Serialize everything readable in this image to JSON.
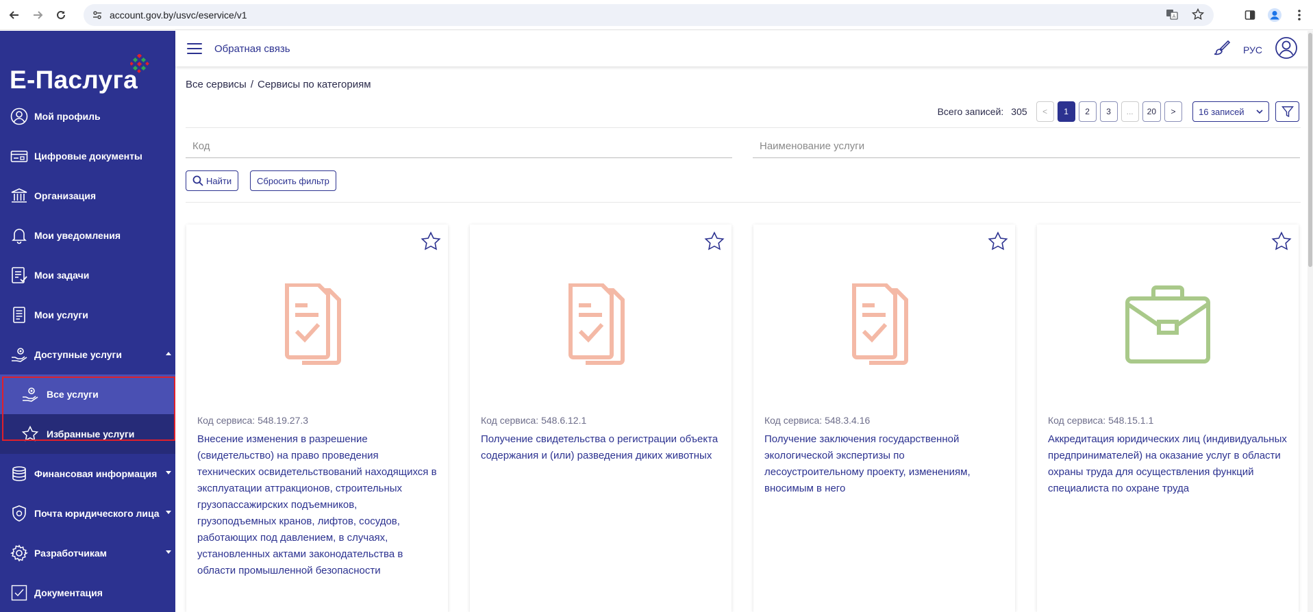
{
  "browser": {
    "url": "account.gov.by/usvc/eservice/v1"
  },
  "sidebar": {
    "logo_text": "Е-Паслуга",
    "items": [
      {
        "label": "Мой профиль",
        "icon": "user-circle-icon"
      },
      {
        "label": "Цифровые документы",
        "icon": "card-icon"
      },
      {
        "label": "Организация",
        "icon": "building-icon"
      },
      {
        "label": "Мои уведомления",
        "icon": "bell-icon"
      },
      {
        "label": "Мои задачи",
        "icon": "task-list-icon"
      },
      {
        "label": "Мои услуги",
        "icon": "document-icon"
      },
      {
        "label": "Доступные услуги",
        "icon": "hand-gear-icon",
        "expanded": true
      },
      {
        "label": "Все услуги",
        "icon": "hand-gear-icon",
        "sub": true,
        "active": true
      },
      {
        "label": "Избранные услуги",
        "icon": "star-icon",
        "sub": true
      },
      {
        "label": "Финансовая информация",
        "icon": "coins-icon"
      },
      {
        "label": "Почта юридического лица",
        "icon": "shield-mail-icon"
      },
      {
        "label": "Разработчикам",
        "icon": "gear-icon"
      },
      {
        "label": "Документация",
        "icon": "checkbox-icon"
      }
    ]
  },
  "topbar": {
    "feedback": "Обратная связь",
    "lang": "РУС"
  },
  "breadcrumb": {
    "root": "Все сервисы",
    "sep": "/",
    "current": "Сервисы по категориям"
  },
  "pager": {
    "label": "Всего записей:",
    "total": "305",
    "prev": "<",
    "pages": [
      "1",
      "2",
      "3",
      "...",
      "20"
    ],
    "next": ">",
    "per_page": "16 записей"
  },
  "filters": {
    "code_placeholder": "Код",
    "name_placeholder": "Наименование услуги",
    "find": "Найти",
    "reset": "Сбросить фильтр"
  },
  "cards": [
    {
      "code": "Код сервиса: 548.19.27.3",
      "title": "Внесение изменения в разрешение (свидетельство) на право проведения технических освидетельствований находящихся в эксплуатации аттракционов, строительных грузопассажирских подъемников, грузоподъемных кранов, лифтов, сосудов, работающих под давлением, в случаях, установленных актами законодательства в области промышленной безопасности",
      "icon": "documents-check-icon"
    },
    {
      "code": "Код сервиса: 548.6.12.1",
      "title": "Получение свидетельства о регистрации объекта содержания и (или) разведения диких животных",
      "icon": "documents-check-icon"
    },
    {
      "code": "Код сервиса: 548.3.4.16",
      "title": "Получение заключения государственной экологической экспертизы по лесоустроительному проекту, изменениям, вносимым в него",
      "icon": "documents-check-icon"
    },
    {
      "code": "Код сервиса: 548.15.1.1",
      "title": "Аккредитация юридических лиц (индивидуальных предпринимателей) на оказание услуг в области охраны труда для осуществления функций специалиста по охране труда",
      "icon": "briefcase-icon"
    }
  ],
  "colors": {
    "brand": "#2c3290",
    "doc_icon": "#f4b9a6",
    "briefcase_icon": "#a9c98a",
    "highlight": "#e0202b"
  }
}
